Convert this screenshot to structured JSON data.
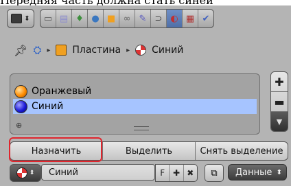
{
  "caption": "Передняя часть должна стать синей",
  "toolbar": {
    "editor_type_icon": "properties-editor-icon",
    "context_buttons": [
      {
        "name": "render-icon",
        "glyph": "▭",
        "color": "#5a5a5a"
      },
      {
        "name": "render-layers-icon",
        "glyph": "▤",
        "color": "#8a8ad0"
      },
      {
        "name": "scene-icon",
        "glyph": "♦",
        "color": "#3d8f3d"
      },
      {
        "name": "world-icon",
        "glyph": "●",
        "color": "#3a77c0"
      },
      {
        "name": "object-icon",
        "glyph": "■",
        "color": "#f0a020"
      },
      {
        "name": "constraints-icon",
        "glyph": "∞",
        "color": "#6b6b6b"
      },
      {
        "name": "modifiers-icon",
        "glyph": "✎",
        "color": "#5a5ac0"
      },
      {
        "name": "object-data-icon",
        "glyph": "⊃",
        "color": "#444"
      },
      {
        "name": "material-icon",
        "glyph": "◐",
        "color": "#c03030",
        "active": true
      },
      {
        "name": "texture-icon",
        "glyph": "▦",
        "color": "#b03030"
      },
      {
        "name": "physics-icon",
        "glyph": "✔",
        "color": "#4060c0"
      }
    ]
  },
  "breadcrumb": {
    "items": [
      {
        "label": "Пластина"
      },
      {
        "label": "Синий"
      }
    ]
  },
  "material_slots": [
    {
      "label": "Оранжевый",
      "color": "#ff8c00",
      "selected": false
    },
    {
      "label": "Синий",
      "color": "#1a1ad8",
      "selected": true
    }
  ],
  "actions": {
    "assign": "Назначить",
    "select": "Выделить",
    "deselect": "Снять выделение"
  },
  "material_field": {
    "name": "Синий",
    "fake_user": "F"
  },
  "data_select": {
    "value": "Данные"
  }
}
